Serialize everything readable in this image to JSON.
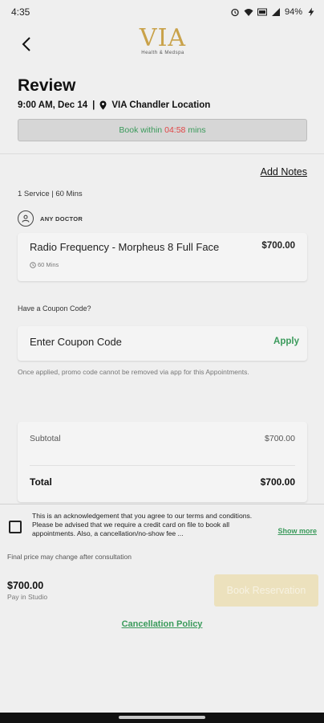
{
  "status_bar": {
    "time": "4:35",
    "battery": "94%"
  },
  "header": {
    "logo_text": "VIA",
    "logo_subtext": "Health & Medspa"
  },
  "page": {
    "title": "Review",
    "appointment_time": "9:00 AM, Dec 14",
    "separator": "|",
    "location": "VIA Chandler Location"
  },
  "timer": {
    "prefix": "Book within",
    "countdown": "04:58",
    "suffix": "mins"
  },
  "notes": {
    "add_notes_label": "Add Notes"
  },
  "services": {
    "summary": "1 Service | 60 Mins",
    "doctor_label": "ANY DOCTOR",
    "items": [
      {
        "name": "Radio Frequency - Morpheus 8 Full Face",
        "price": "$700.00",
        "duration": "60 Mins"
      }
    ]
  },
  "coupon": {
    "question": "Have a Coupon Code?",
    "placeholder": "Enter Coupon Code",
    "apply_label": "Apply",
    "note": "Once applied, promo code cannot be removed via app for this Appointments."
  },
  "totals": {
    "subtotal_label": "Subtotal",
    "subtotal_value": "$700.00",
    "total_label": "Total",
    "total_value": "$700.00"
  },
  "footer": {
    "acknowledgement_text": "This is an acknowledgement that you agree to our terms and conditions. Please be advised that we require a credit card on file to book all appointments. Also, a cancellation/no-show fee ...",
    "show_more_label": "Show more",
    "final_price_note": "Final price may change after consultation",
    "pay_amount": "$700.00",
    "pay_subtext": "Pay in Studio",
    "book_button_label": "Book Reservation",
    "cancellation_policy_label": "Cancellation Policy"
  },
  "colors": {
    "accent_green": "#3a9a5b",
    "countdown_red": "#e04545",
    "brand_gold": "#c9a24a",
    "disabled_button": "#ece1bd"
  }
}
